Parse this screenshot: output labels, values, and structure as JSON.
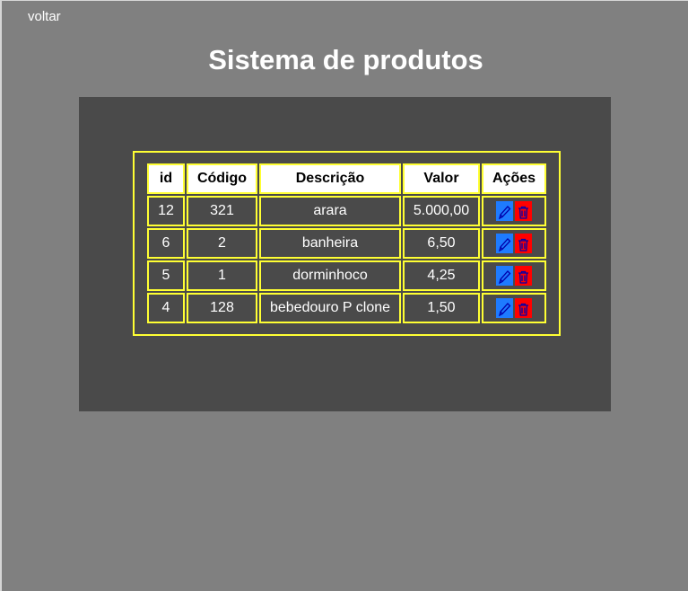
{
  "nav": {
    "back_label": "voltar"
  },
  "page": {
    "title": "Sistema de produtos"
  },
  "table": {
    "headers": {
      "id": "id",
      "code": "Código",
      "description": "Descrição",
      "value": "Valor",
      "actions": "Ações"
    },
    "rows": [
      {
        "id": "12",
        "code": "321",
        "description": "arara",
        "value": "5.000,00"
      },
      {
        "id": "6",
        "code": "2",
        "description": "banheira",
        "value": "6,50"
      },
      {
        "id": "5",
        "code": "1",
        "description": "dorminhoco",
        "value": "4,25"
      },
      {
        "id": "4",
        "code": "128",
        "description": "bebedouro P clone",
        "value": "1,50"
      }
    ],
    "row_actions": {
      "edit_icon": "pencil-icon",
      "delete_icon": "trash-icon"
    }
  },
  "colors": {
    "page_background": "#808080",
    "panel_background": "#4a4a4a",
    "table_border": "#ffff33",
    "edit_button": "#1e7bff",
    "delete_button": "#ff0000"
  }
}
